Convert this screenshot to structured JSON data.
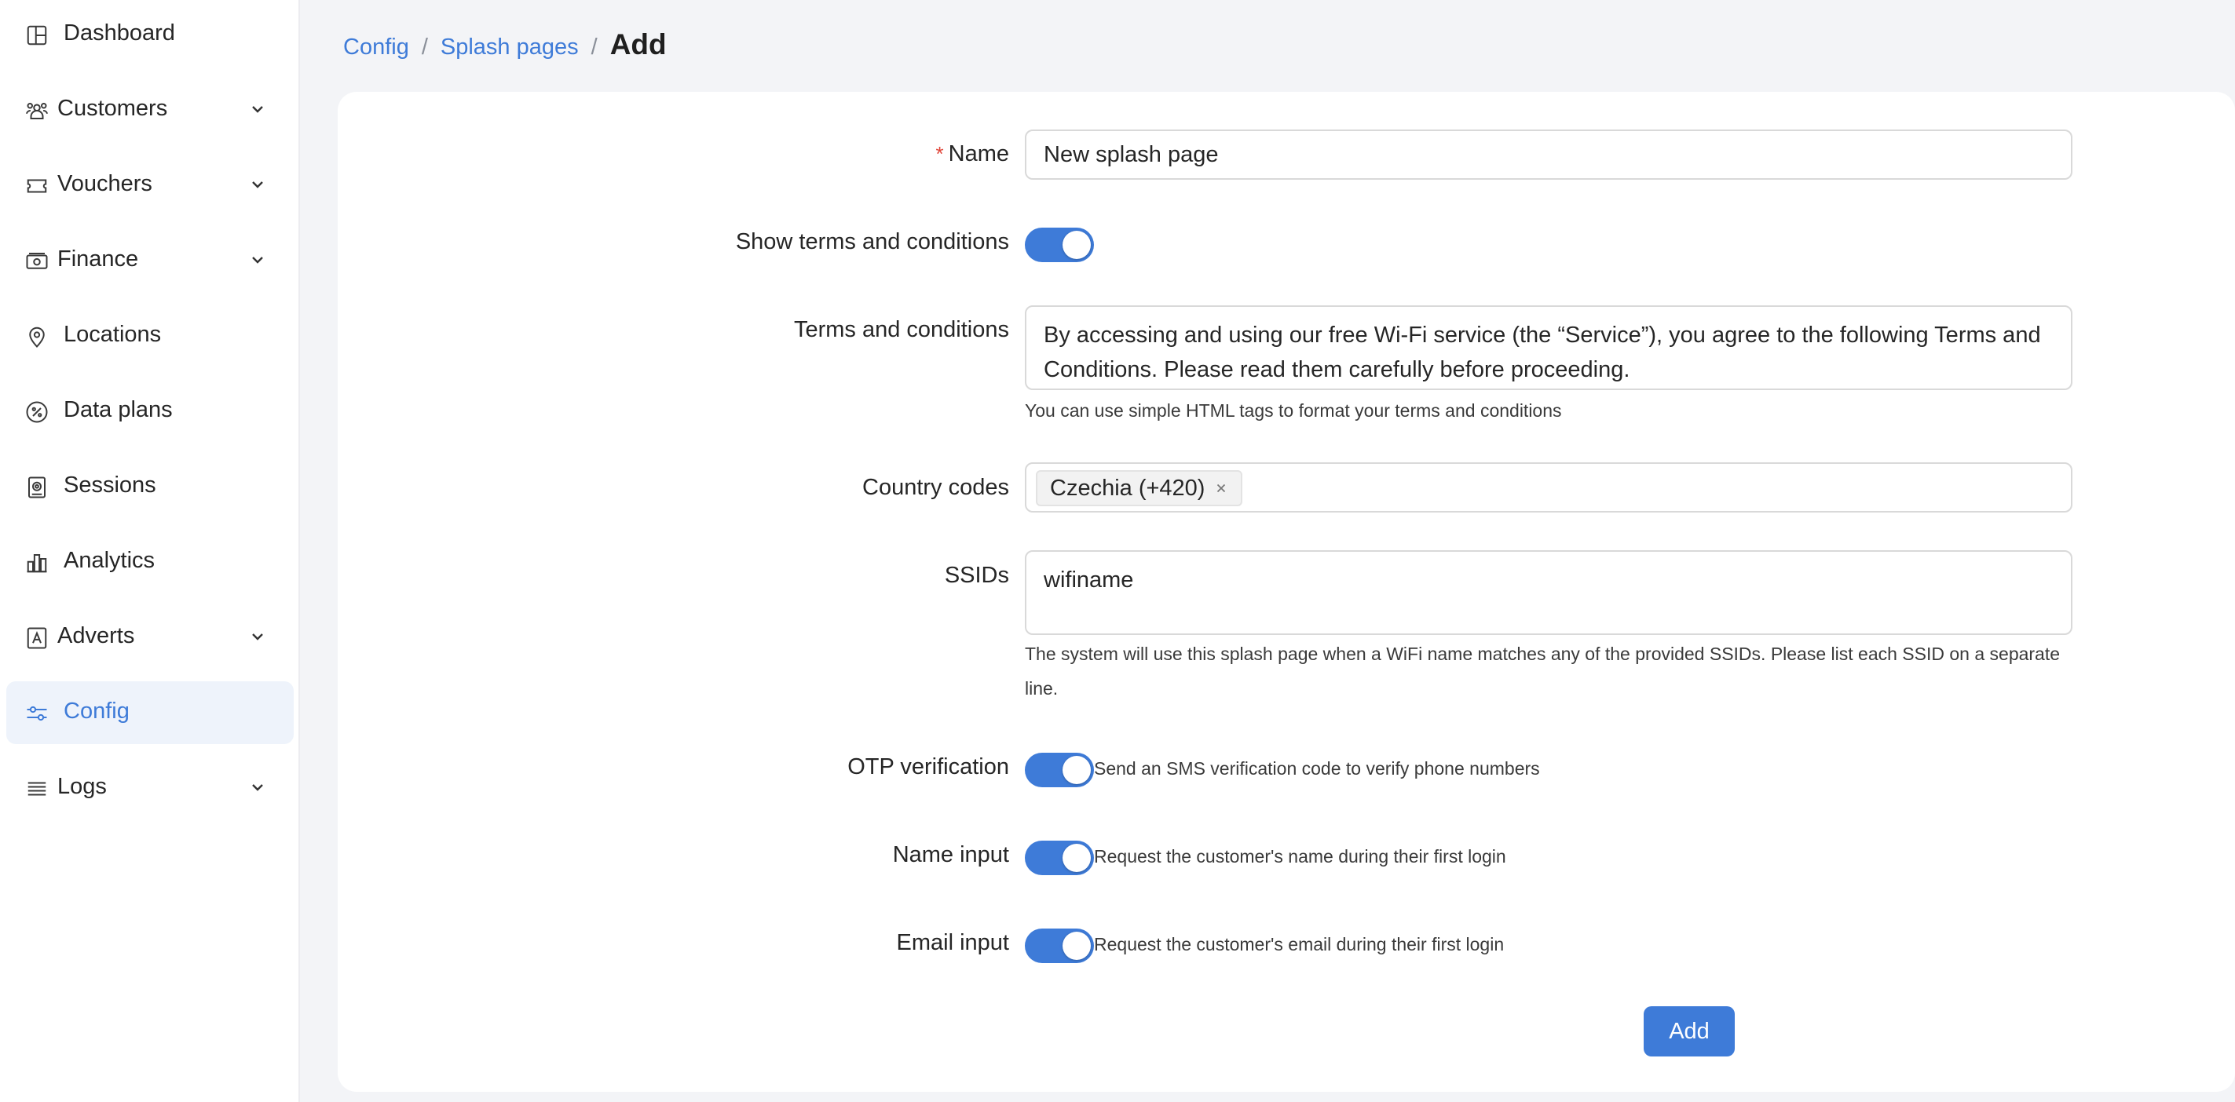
{
  "sidebar": {
    "items": [
      {
        "label": "Dashboard",
        "icon": "dashboard-icon",
        "has_children": false
      },
      {
        "label": "Customers",
        "icon": "customers-icon",
        "has_children": true
      },
      {
        "label": "Vouchers",
        "icon": "ticket-icon",
        "has_children": true
      },
      {
        "label": "Finance",
        "icon": "money-icon",
        "has_children": true
      },
      {
        "label": "Locations",
        "icon": "location-pin-icon",
        "has_children": false
      },
      {
        "label": "Data plans",
        "icon": "percentage-icon",
        "has_children": false
      },
      {
        "label": "Sessions",
        "icon": "session-icon",
        "has_children": false
      },
      {
        "label": "Analytics",
        "icon": "bar-chart-icon",
        "has_children": false
      },
      {
        "label": "Adverts",
        "icon": "advert-icon",
        "has_children": true
      },
      {
        "label": "Config",
        "icon": "sliders-icon",
        "has_children": false,
        "active": true
      },
      {
        "label": "Logs",
        "icon": "list-icon",
        "has_children": true
      }
    ]
  },
  "breadcrumb": {
    "items": [
      "Config",
      "Splash pages"
    ],
    "separator": "/",
    "current": "Add"
  },
  "form": {
    "name": {
      "label": "Name",
      "required_mark": "*",
      "value": "New splash page"
    },
    "show_terms": {
      "label": "Show terms and conditions",
      "checked": true
    },
    "terms": {
      "label": "Terms and conditions",
      "value": "By accessing and using our free Wi-Fi service (the “Service”), you agree to the following Terms and Conditions. Please read them carefully before proceeding.",
      "help": "You can use simple HTML tags to format your terms and conditions"
    },
    "country_codes": {
      "label": "Country codes",
      "tags": [
        "Czechia (+420)"
      ]
    },
    "ssids": {
      "label": "SSIDs",
      "value": "wifiname",
      "help": "The system will use this splash page when a WiFi name matches any of the provided SSIDs. Please list each SSID on a separate line."
    },
    "otp": {
      "label": "OTP verification",
      "checked": true,
      "description": "Send an SMS verification code to verify phone numbers"
    },
    "name_input": {
      "label": "Name input",
      "checked": true,
      "description": "Request the customer's name during their first login"
    },
    "email_input": {
      "label": "Email input",
      "checked": true,
      "description": "Request the customer's email during their first login"
    },
    "submit_label": "Add"
  },
  "colors": {
    "accent": "#3e7bd8",
    "required": "#e0463a",
    "active_nav_bg": "#eef3fb"
  }
}
